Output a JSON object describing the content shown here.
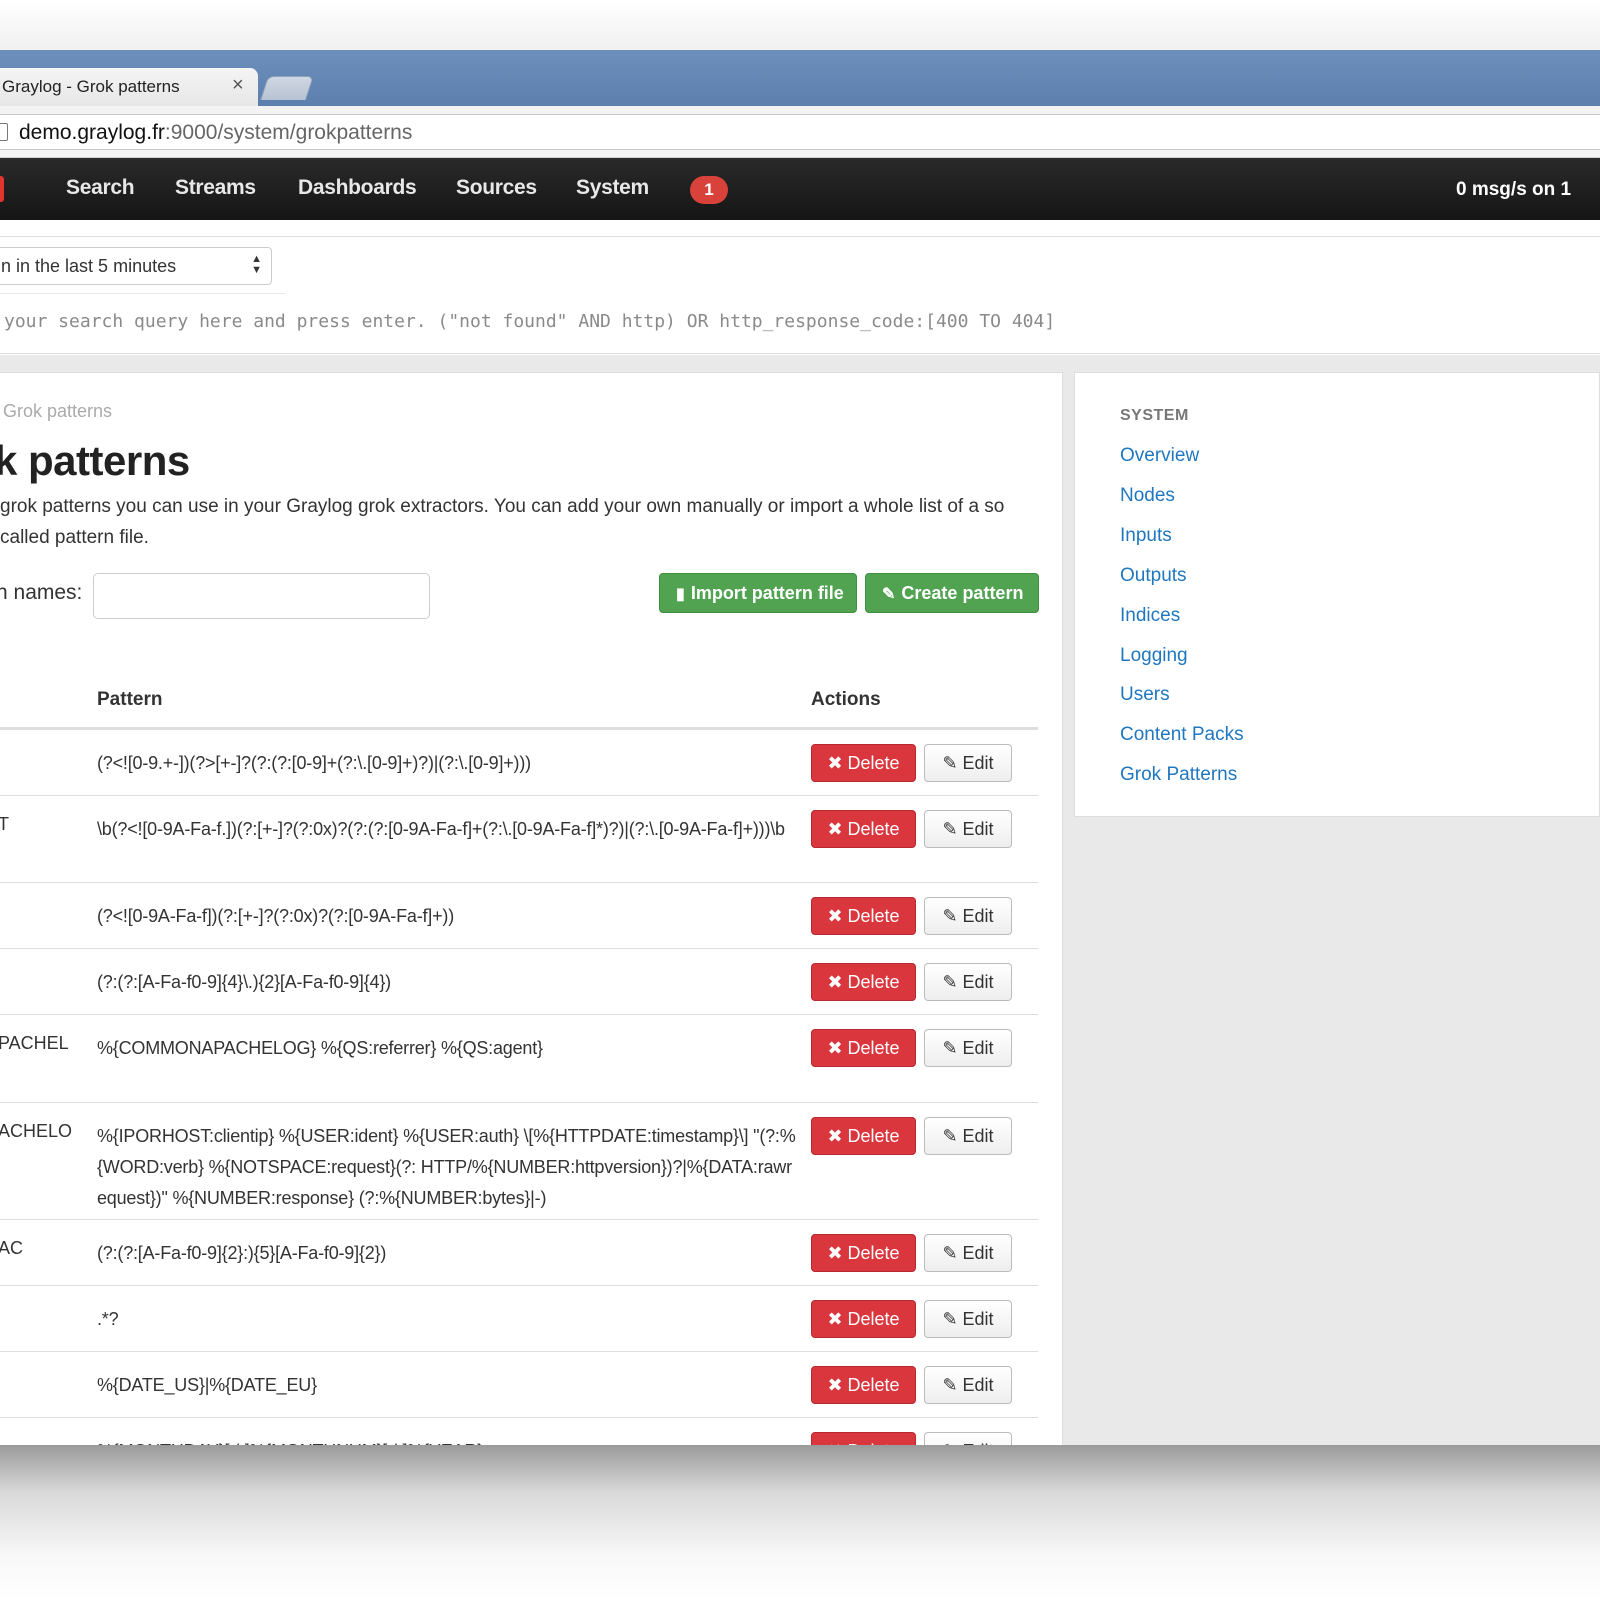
{
  "browser": {
    "tab_title": "Graylog - Grok patterns",
    "tab_close": "×",
    "url_host": "demo.graylog.fr",
    "url_path": ":9000/system/grokpatterns"
  },
  "navbar": {
    "items": [
      "Search",
      "Streams",
      "Dashboards",
      "Sources",
      "System"
    ],
    "notification_count": "1",
    "throughput": "0 msg/s on 1"
  },
  "search": {
    "range": "n in the last 5 minutes",
    "placeholder": " your search query here and press enter. (\"not found\" AND http) OR http_response_code:[400 TO 404]"
  },
  "page": {
    "breadcrumb": "Grok patterns",
    "title": "k patterns",
    "description": "grok patterns you can use in your Graylog grok extractors. You can add your own manually or import a whole list of a so called pattern file.",
    "filter_label": "n names:",
    "import_button": "Import pattern file",
    "create_button": "Create pattern"
  },
  "table": {
    "headers": {
      "pattern": "Pattern",
      "actions": "Actions"
    },
    "delete_label": "Delete",
    "edit_label": "Edit",
    "rows": [
      {
        "name": "",
        "pattern": "(?<![0-9.+-])(?>[+-]?(?:(?:[0-9]+(?:\\.[0-9]+)?)|(?:\\.[0-9]+)))"
      },
      {
        "name": "T",
        "pattern": "\\b(?<![0-9A-Fa-f.])(?:[+-]?(?:0x)?(?:(?:[0-9A-Fa-f]+(?:\\.[0-9A-Fa-f]*)?)|(?:\\.[0-9A-Fa-f]+)))\\b"
      },
      {
        "name": "",
        "pattern": "(?<![0-9A-Fa-f])(?:[+-]?(?:0x)?(?:[0-9A-Fa-f]+))"
      },
      {
        "name": "",
        "pattern": "(?:(?:[A-Fa-f0-9]{4}\\.){2}[A-Fa-f0-9]{4})"
      },
      {
        "name": "PACHEL",
        "pattern": "%{COMMONAPACHELOG} %{QS:referrer} %{QS:agent}"
      },
      {
        "name": "ACHELO",
        "pattern": "%{IPORHOST:clientip} %{USER:ident} %{USER:auth} \\[%{HTTPDATE:timestamp}\\] \"(?:%{WORD:verb} %{NOTSPACE:request}(?: HTTP/%{NUMBER:httpversion})?|%{DATA:rawrequest})\" %{NUMBER:response} (?:%{NUMBER:bytes}|-)"
      },
      {
        "name": "AC",
        "pattern": "(?:(?:[A-Fa-f0-9]{2}:){5}[A-Fa-f0-9]{2})"
      },
      {
        "name": "",
        "pattern": ".*?"
      },
      {
        "name": "",
        "pattern": "%{DATE_US}|%{DATE_EU}"
      },
      {
        "name": "",
        "pattern": "%{MONTHDAY}[./-]%{MONTHNUM}[./-]%{YEAR}"
      }
    ]
  },
  "sidebar": {
    "heading": "SYSTEM",
    "links": [
      "Overview",
      "Nodes",
      "Inputs",
      "Outputs",
      "Indices",
      "Logging",
      "Users",
      "Content Packs",
      "Grok Patterns"
    ]
  },
  "colors": {
    "nav_bg": "#1c1c1c",
    "danger": "#d9363e",
    "success": "#51a351",
    "link": "#1f77c0"
  }
}
